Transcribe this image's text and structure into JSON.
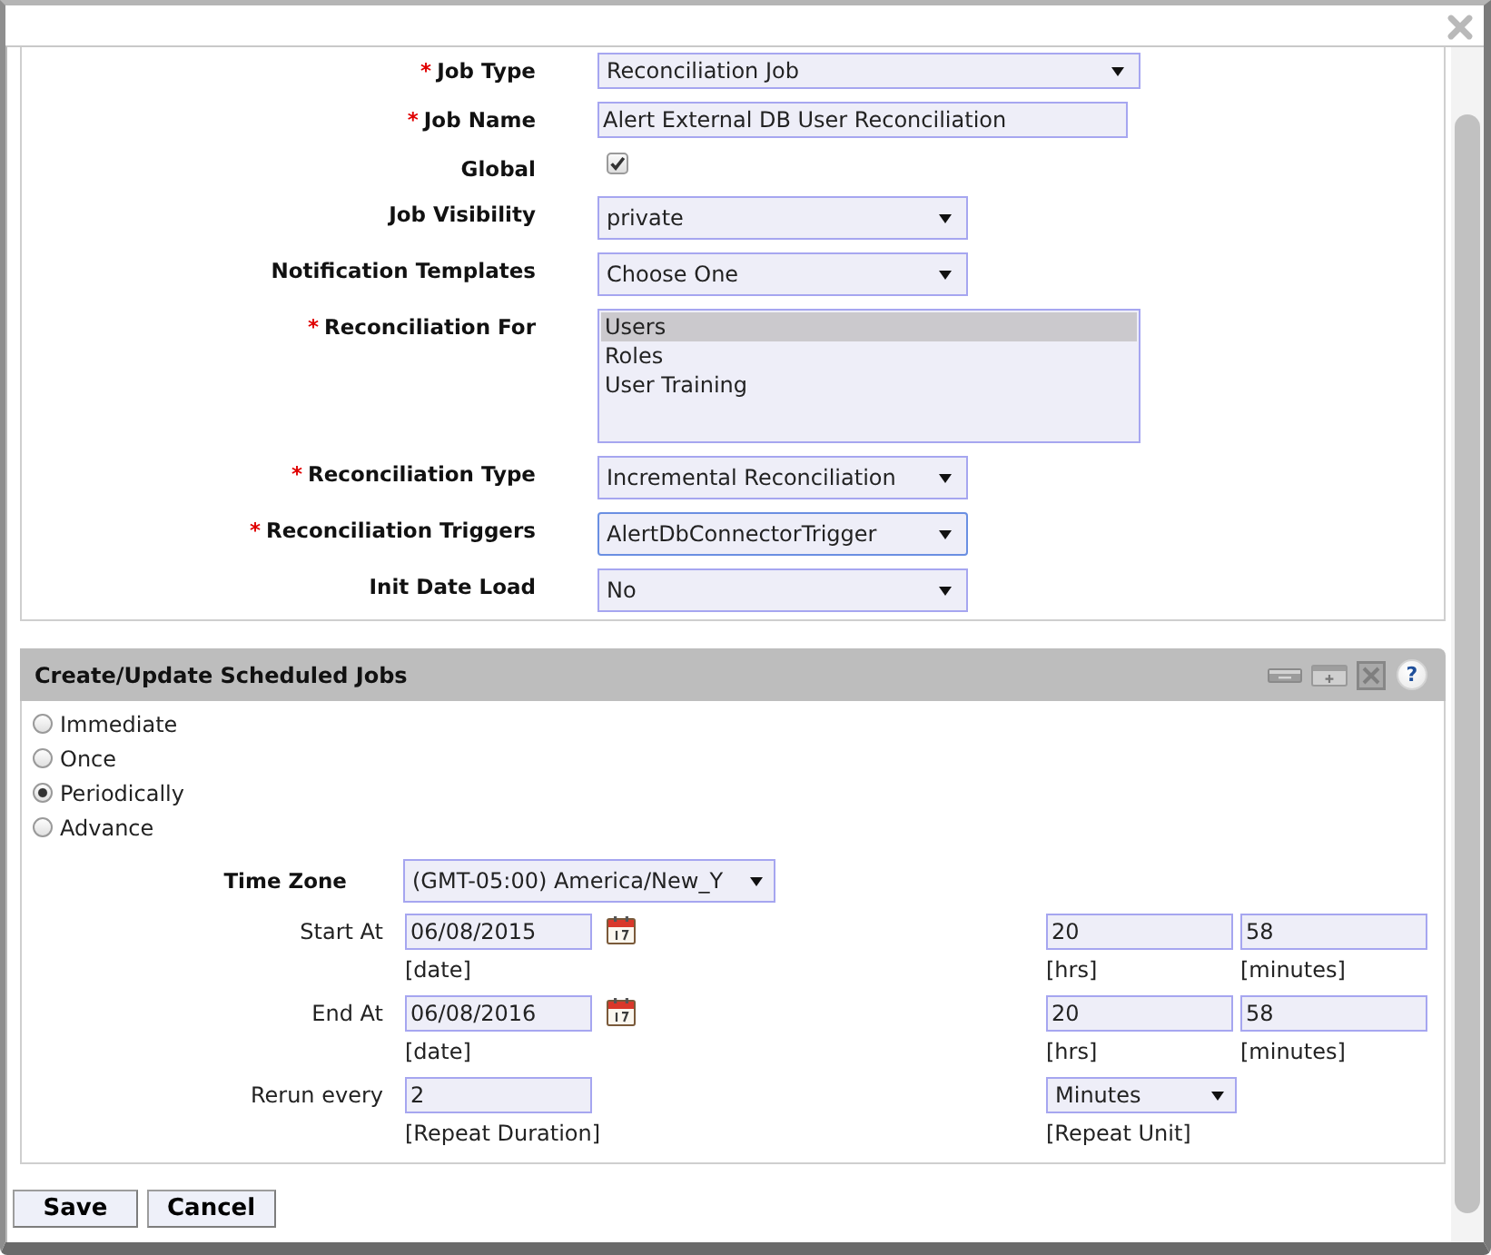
{
  "job_form": {
    "fields": [
      {
        "kind": "select",
        "label": "Job Type",
        "required_mark": "*",
        "value": "Reconciliation Job",
        "focused": false
      },
      {
        "kind": "text",
        "label": "Job Name",
        "required_mark": "*",
        "value": "Alert External DB User Reconciliation"
      },
      {
        "kind": "checkbox",
        "label": "Global",
        "checked": true
      },
      {
        "kind": "select",
        "label": "Job Visibility",
        "value": "private",
        "focused": false
      },
      {
        "kind": "select",
        "label": "Notification Templates",
        "value": "Choose One",
        "focused": false
      },
      {
        "kind": "listbox",
        "label": "Reconciliation For",
        "required_mark": "*",
        "options": [
          {
            "label": "Users",
            "selected": true
          },
          {
            "label": "Roles",
            "selected": false
          },
          {
            "label": "User Training",
            "selected": false
          }
        ]
      },
      {
        "kind": "select",
        "label": "Reconciliation Type",
        "required_mark": "*",
        "value": "Incremental Reconciliation",
        "focused": false
      },
      {
        "kind": "select",
        "label": "Reconciliation Triggers",
        "required_mark": "*",
        "value": "AlertDbConnectorTrigger",
        "focused": true
      },
      {
        "kind": "select",
        "label": "Init Date Load",
        "value": "No",
        "focused": false
      }
    ]
  },
  "schedule": {
    "title": "Create/Update Scheduled Jobs",
    "help": "?",
    "frequency": [
      {
        "label": "Immediate",
        "selected": false
      },
      {
        "label": "Once",
        "selected": false
      },
      {
        "label": "Periodically",
        "selected": true
      },
      {
        "label": "Advance",
        "selected": false
      }
    ],
    "time_zone": {
      "label": "Time Zone",
      "value": "(GMT-05:00) America/New_Y"
    },
    "start": {
      "label": "Start At",
      "date": "06/08/2015",
      "date_hint": "[date]",
      "hours": "20",
      "hours_hint": "[hrs]",
      "minutes": "58",
      "minutes_hint": "[minutes]"
    },
    "end": {
      "label": "End At",
      "date": "06/08/2016",
      "date_hint": "[date]",
      "hours": "20",
      "hours_hint": "[hrs]",
      "minutes": "58",
      "minutes_hint": "[minutes]"
    },
    "rerun": {
      "label": "Rerun every",
      "value": "2",
      "value_hint": "[Repeat Duration]",
      "unit": "Minutes",
      "unit_hint": "[Repeat Unit]"
    }
  },
  "buttons": [
    "Save",
    "Cancel"
  ]
}
